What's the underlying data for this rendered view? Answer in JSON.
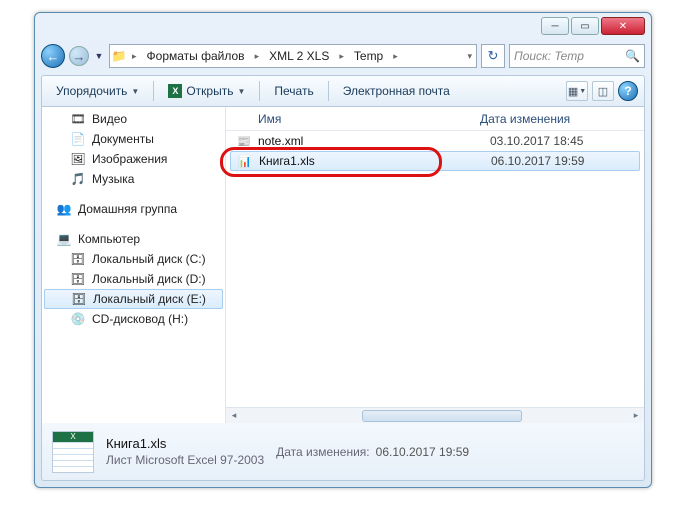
{
  "breadcrumb": {
    "a": "Форматы файлов",
    "b": "XML 2 XLS",
    "c": "Temp"
  },
  "search": {
    "placeholder": "Поиск: Temp"
  },
  "toolbar": {
    "organize": "Упорядочить",
    "open": "Открыть",
    "print": "Печать",
    "email": "Электронная почта"
  },
  "nav": {
    "video": "Видео",
    "docs": "Документы",
    "pics": "Изображения",
    "music": "Музыка",
    "homegroup": "Домашняя группа",
    "computer": "Компьютер",
    "disk_c": "Локальный диск (C:)",
    "disk_d": "Локальный диск (D:)",
    "disk_e": "Локальный диск (E:)",
    "cd": "CD-дисковод (H:)"
  },
  "cols": {
    "name": "Имя",
    "date": "Дата изменения"
  },
  "files": [
    {
      "name": "note.xml",
      "date": "03.10.2017 18:45"
    },
    {
      "name": "Книга1.xls",
      "date": "06.10.2017 19:59"
    }
  ],
  "details": {
    "name": "Книга1.xls",
    "type": "Лист Microsoft Excel 97-2003",
    "date_label": "Дата изменения:",
    "date": "06.10.2017 19:59"
  }
}
